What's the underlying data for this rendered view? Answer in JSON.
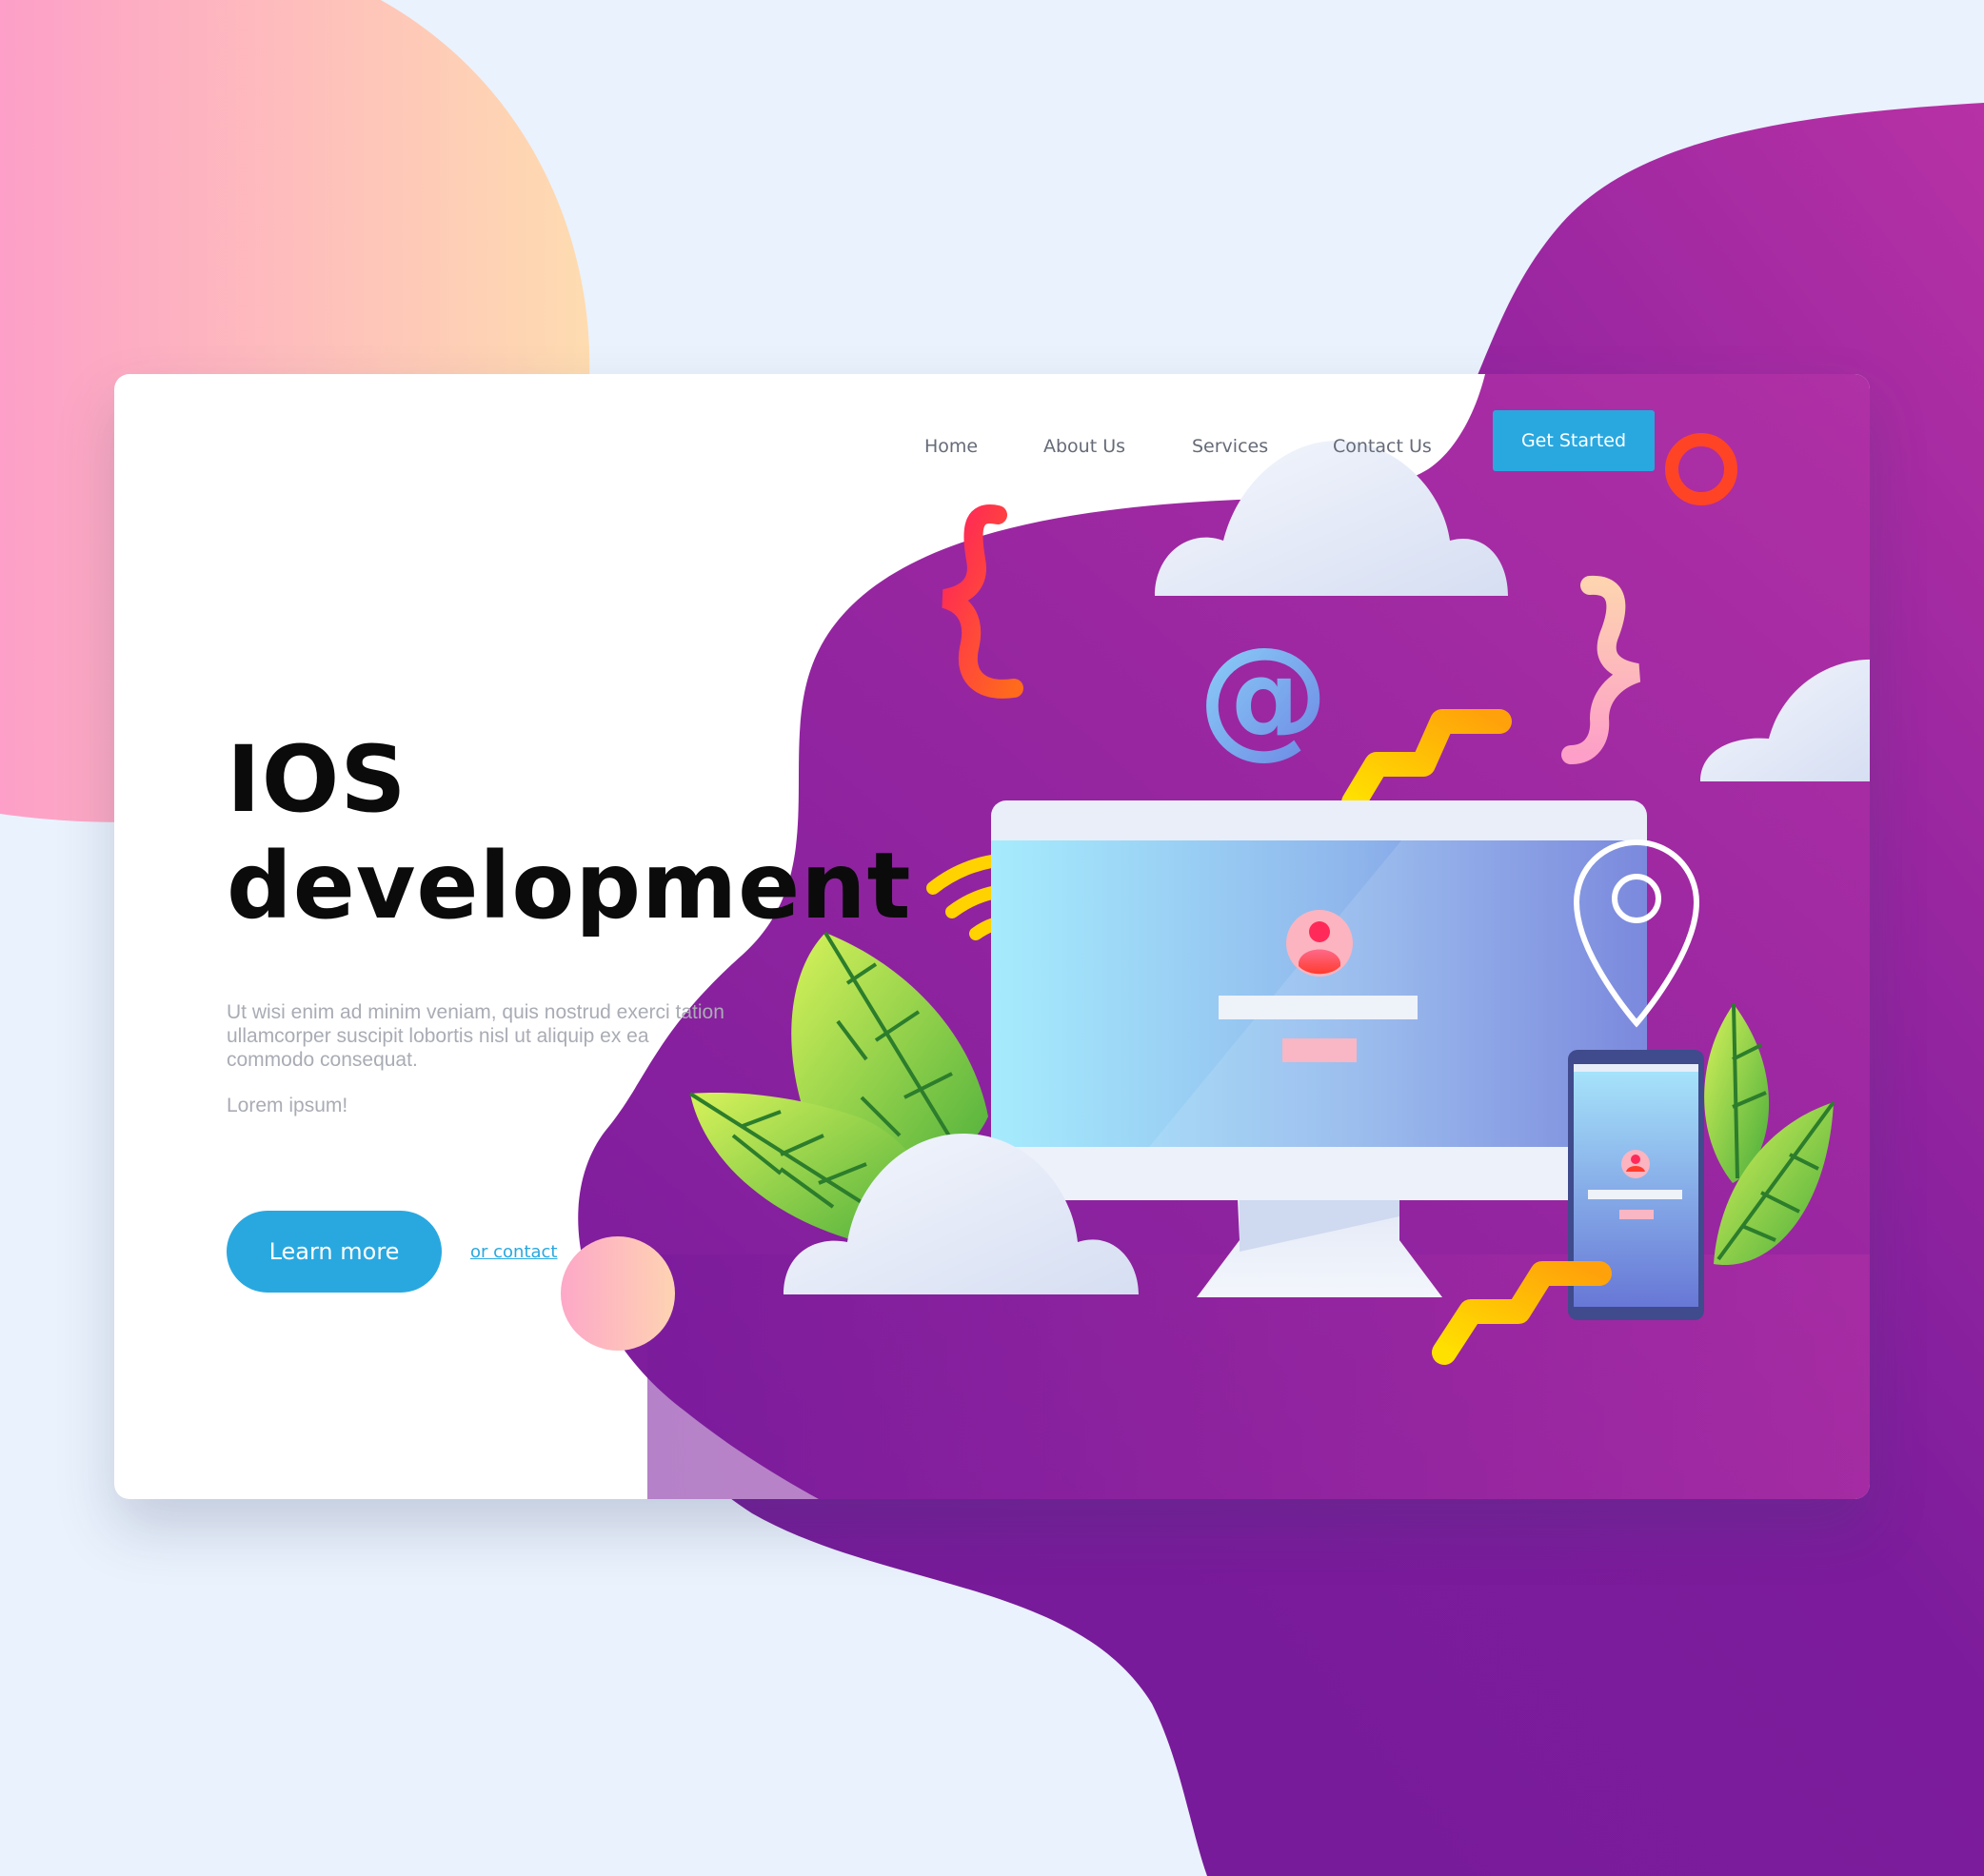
{
  "nav": {
    "links": [
      "Home",
      "About Us",
      "Services",
      "Contact Us"
    ],
    "cta_label": "Get Started"
  },
  "hero": {
    "title_line1": "IOS",
    "title_line2": "development",
    "body": "Ut wisi enim ad minim veniam, quis nostrud exerci tation ullamcorper suscipit lobortis nisl ut aliquip ex ea commodo consequat.",
    "sub": "Lorem ipsum!",
    "primary_button": "Learn more",
    "secondary_link": "or contact"
  },
  "colors": {
    "accent_blue": "#29a8e0",
    "purple_dark": "#761b9a",
    "purple_light": "#b62fa5",
    "peach": "#fdd3b3",
    "pink": "#fd9fc8",
    "yellow": "#ffd200",
    "orange_red": "#ff4425"
  },
  "icons": [
    "curly-brace-open-icon",
    "curly-brace-close-icon",
    "at-sign-icon",
    "wifi-icon",
    "location-pin-icon",
    "user-avatar-icon",
    "cloud-icon",
    "leaf-icon",
    "ring-icon",
    "zigzag-icon"
  ]
}
